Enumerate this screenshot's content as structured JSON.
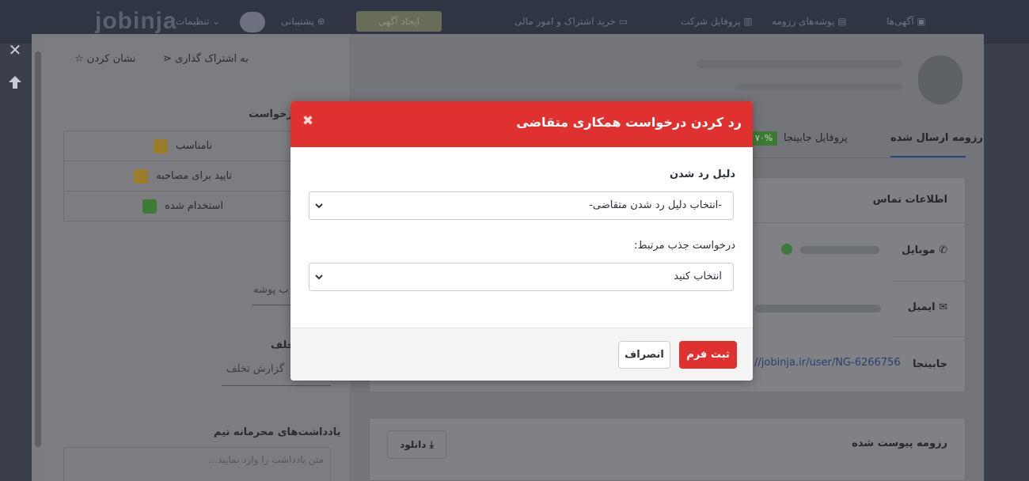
{
  "topnav": {
    "logo": "jobinja",
    "items": [
      {
        "label": "آگهی‌ها",
        "icon": "briefcase-icon"
      },
      {
        "label": "پوشه‌های رزومه",
        "icon": "folder-icon"
      },
      {
        "label": "پروفایل شرکت",
        "icon": "building-icon"
      },
      {
        "label": "خرید اشتراک و امور مالی",
        "icon": "card-icon"
      }
    ],
    "post_ad_label": "ایجاد آگهی",
    "support_label": "پشتیبانی",
    "notifications_label": "تنظیمات"
  },
  "left_panel": {
    "share_label": "به اشتراک گذاری",
    "bookmark_label": "نشان کردن",
    "section_title": "درخواست",
    "statuses": [
      {
        "label": "نامناسب",
        "icon": "thumbs-down-icon"
      },
      {
        "label": "تایید برای مصاحبه",
        "icon": "thumbs-up-icon"
      },
      {
        "label": "استخدام شده",
        "icon": "check-box-icon"
      }
    ],
    "folder_placeholder": "ب پوشه",
    "violation_title": "خلف",
    "violation_placeholder": "گزارش تخلف",
    "notes_title": "یادداشت‌های محرمانه تیم",
    "notes_placeholder": "متن یادداشت را وارد نمایید..."
  },
  "profile": {
    "tabs": [
      {
        "label": "رزومه ارسال شده",
        "active": true
      },
      {
        "label": "پروفایل جابینجا",
        "active": false
      }
    ],
    "completion_badge": "۷۰%",
    "contact": {
      "title": "اطلاعات تماس",
      "mobile_label": "موبایل",
      "email_label": "ایمیل",
      "jobinja_label": "جابینجا",
      "jobinja_value": "//jobinja.ir/user/NG-6266756"
    },
    "attached_resume": {
      "title": "رزومه پیوست شده",
      "download_label": "دانلود"
    }
  },
  "modal": {
    "title": "رد کردن درخواست همکاری متقاضی",
    "reason_label": "دلیل رد شدن",
    "reason_select_value": "-انتخاب دلیل رد شدن متقاضی-",
    "related_label": "درخواست جذب مرتبط:",
    "related_select_value": "انتخاب کنید",
    "submit_label": "ثبت فرم",
    "cancel_label": "انصراف"
  },
  "colors": {
    "accent_red": "#e03131",
    "overlay_dark": "#3a3f4b",
    "tab_active": "#29477a"
  }
}
